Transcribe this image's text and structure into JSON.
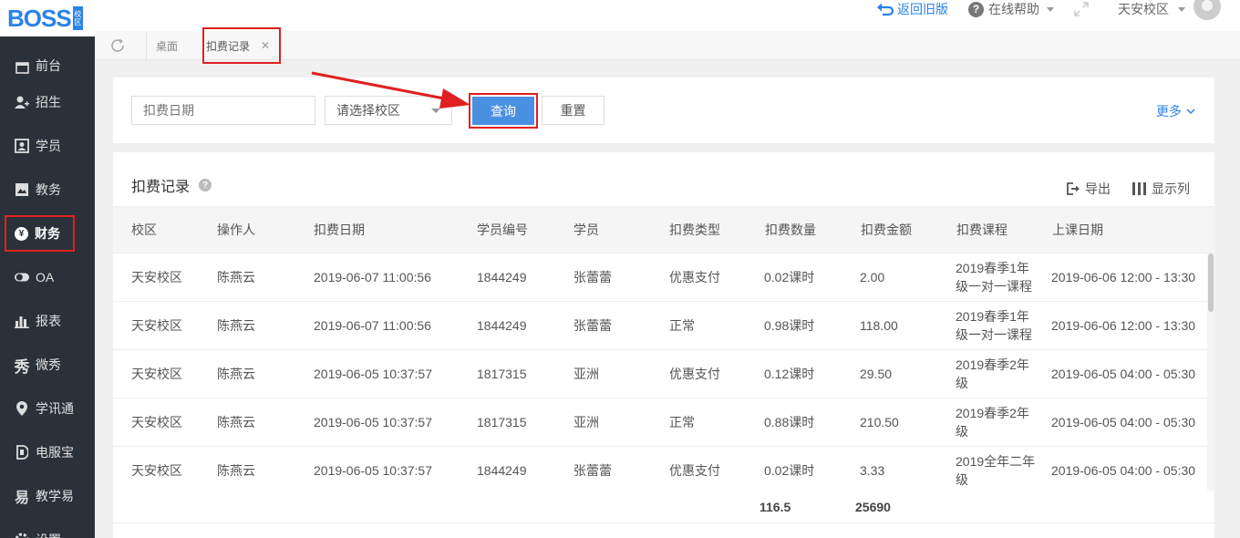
{
  "brand": {
    "logo": "BOSS",
    "logo_tag": "校区"
  },
  "sidebar": {
    "items": [
      {
        "label": "前台",
        "icon": "calendar-icon"
      },
      {
        "label": "招生",
        "icon": "user-add-icon"
      },
      {
        "label": "学员",
        "icon": "id-card-icon"
      },
      {
        "label": "教务",
        "icon": "book-icon"
      },
      {
        "label": "财务",
        "icon": "yen-icon"
      },
      {
        "label": "OA",
        "icon": "toggle-icon"
      },
      {
        "label": "报表",
        "icon": "bar-chart-icon"
      },
      {
        "label": "微秀",
        "icon": "xiu-icon"
      },
      {
        "label": "学讯通",
        "icon": "location-icon"
      },
      {
        "label": "电服宝",
        "icon": "service-icon"
      },
      {
        "label": "教学易",
        "icon": "teach-icon"
      },
      {
        "label": "设置",
        "icon": "gear-icon"
      }
    ],
    "active_index": 4
  },
  "topbar": {
    "back_label": "返回旧版",
    "help_label": "在线帮助",
    "campus_label": "天安校区"
  },
  "tabs": {
    "desktop": "桌面",
    "active": "扣费记录"
  },
  "filters": {
    "date_placeholder": "扣费日期",
    "campus_placeholder": "请选择校区",
    "query_label": "查询",
    "reset_label": "重置",
    "more_label": "更多"
  },
  "table": {
    "title": "扣费记录",
    "export_label": "导出",
    "columns_label": "显示列",
    "headers": [
      "校区",
      "操作人",
      "扣费日期",
      "学员编号",
      "学员",
      "扣费类型",
      "扣费数量",
      "扣费金额",
      "扣费课程",
      "上课日期"
    ],
    "rows": [
      [
        "天安校区",
        "陈燕云",
        "2019-06-07 11:00:56",
        "1844249",
        "张蕾蕾",
        "优惠支付",
        "0.02课时",
        "2.00",
        "2019春季1年级一对一课程",
        "2019-06-06 12:00 - 13:30"
      ],
      [
        "天安校区",
        "陈燕云",
        "2019-06-07 11:00:56",
        "1844249",
        "张蕾蕾",
        "正常",
        "0.98课时",
        "118.00",
        "2019春季1年级一对一课程",
        "2019-06-06 12:00 - 13:30"
      ],
      [
        "天安校区",
        "陈燕云",
        "2019-06-05 10:37:57",
        "1817315",
        "亚洲",
        "优惠支付",
        "0.12课时",
        "29.50",
        "2019春季2年级",
        "2019-06-05 04:00 - 05:30"
      ],
      [
        "天安校区",
        "陈燕云",
        "2019-06-05 10:37:57",
        "1817315",
        "亚洲",
        "正常",
        "0.88课时",
        "210.50",
        "2019春季2年级",
        "2019-06-05 04:00 - 05:30"
      ],
      [
        "天安校区",
        "陈燕云",
        "2019-06-05 10:37:57",
        "1844249",
        "张蕾蕾",
        "优惠支付",
        "0.02课时",
        "3.33",
        "2019全年二年级",
        "2019-06-05 04:00 - 05:30"
      ]
    ],
    "summary": {
      "quantity": "116.5",
      "amount": "25690"
    }
  },
  "colors": {
    "accent": "#4a90e2",
    "link": "#2b82e9",
    "highlight": "#e02020",
    "sidebar_bg": "#2b3138"
  }
}
